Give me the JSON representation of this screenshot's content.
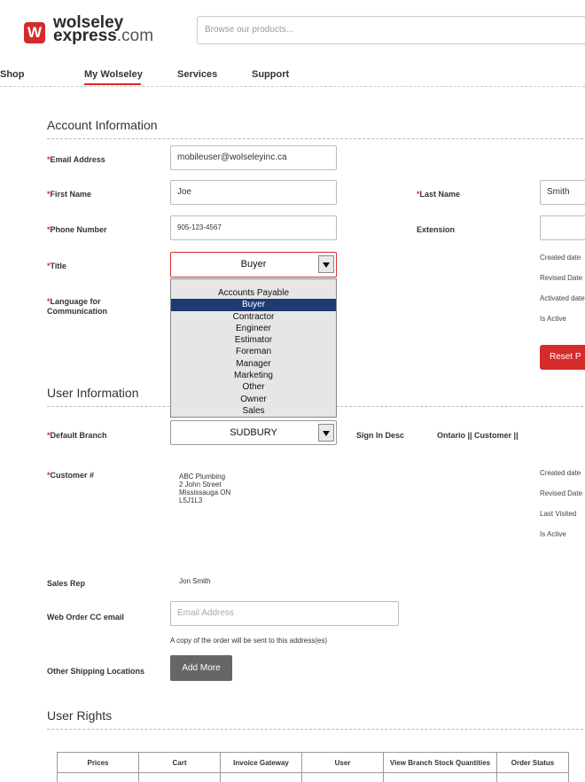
{
  "header": {
    "logo_letter": "W",
    "logo_line1": "wolseley",
    "logo_line2_main": "express",
    "logo_line2_suffix": ".com",
    "search_placeholder": "Browse our products..."
  },
  "nav": [
    "Shop",
    "My Wolseley",
    "Services",
    "Support"
  ],
  "account": {
    "heading": "Account Information",
    "email_label": "Email Address",
    "email_value": "mobileuser@wolseleyinc.ca",
    "first_label": "First Name",
    "first_value": "Joe",
    "last_label": "Last Name",
    "last_value": "Smith",
    "phone_label": "Phone Number",
    "phone_value": "905-123-4567",
    "ext_label": "Extension",
    "title_label": "Title",
    "title_value": "Buyer",
    "lang_label_1": "Language for",
    "lang_label_2": "Communication",
    "side": [
      "Created date",
      "Revised Date",
      "Activated date",
      "Is Active"
    ],
    "reset_label": "Reset P"
  },
  "title_options": [
    "Accounts Payable",
    "Buyer",
    "Contractor",
    "Engineer",
    "Estimator",
    "Foreman",
    "Manager",
    "Marketing",
    "Other",
    "Owner",
    "Sales"
  ],
  "user": {
    "heading": "User Information",
    "branch_label": "Default Branch",
    "branch_value": "SUDBURY",
    "signin_label": "Sign In Desc",
    "signin_value": "Ontario || Customer ||",
    "customer_label": "Customer #",
    "customer_lines": [
      "ABC Plumbing",
      "2 John Street",
      "Mississauga ON",
      "L5J1L3"
    ],
    "side": [
      "Created date",
      "Revised Date",
      "Last Visited",
      "Is Active"
    ],
    "salesrep_label": "Sales Rep",
    "salesrep_value": "Jon Smith",
    "cc_label": "Web Order CC email",
    "cc_placeholder": "Email Address",
    "cc_note": "A copy of the order will be sent to this address(es)",
    "ship_label": "Other Shipping Locations",
    "add_more": "Add More"
  },
  "rights": {
    "heading": "User Rights",
    "columns": [
      "Prices",
      "Cart",
      "Invoice Gateway",
      "User",
      "View Branch Stock Quantities",
      "Order Status"
    ]
  },
  "colors": {
    "brand_red": "#d52b2b",
    "selected_option": "#1e3a73",
    "button_dark": "#666666"
  }
}
